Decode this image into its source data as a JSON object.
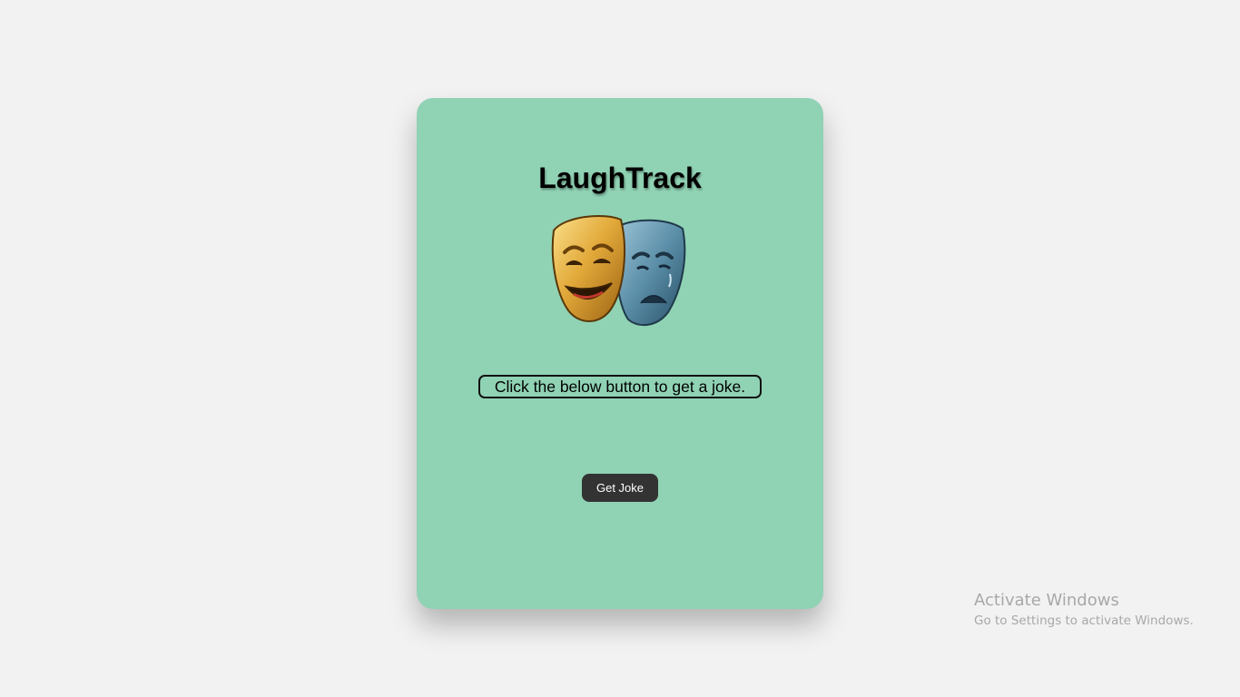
{
  "app": {
    "title": "LaughTrack",
    "logo_icon": "comedy-tragedy-masks-icon"
  },
  "main": {
    "prompt_text": "Click the below button to get a joke.",
    "button_label": "Get Joke"
  },
  "colors": {
    "page_background": "#f2f2f2",
    "card_background": "#90d2b4",
    "button_background": "#333333",
    "button_text": "#ffffff"
  },
  "watermark": {
    "title": "Activate Windows",
    "subtitle": "Go to Settings to activate Windows."
  }
}
